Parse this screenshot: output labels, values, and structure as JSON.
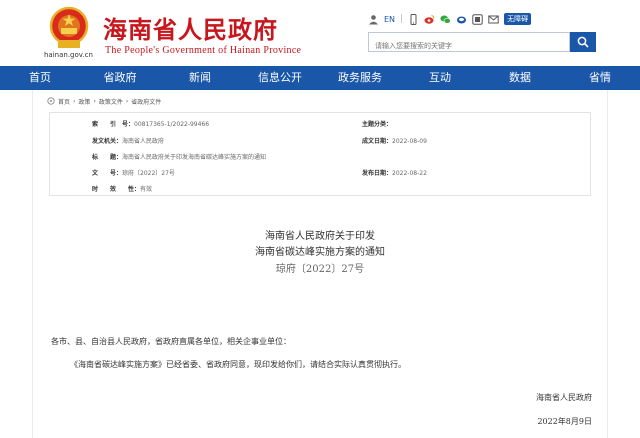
{
  "header": {
    "domain": "hainan.gov.cn",
    "title": "海南省人民政府",
    "subtitle": "The People's Government of Hainan Province",
    "tools": {
      "lang": "EN",
      "accessibility": "无障碍"
    },
    "search_placeholder": "请输入您要搜索的关键字"
  },
  "nav": [
    "首页",
    "省政府",
    "新闻",
    "信息公开",
    "政务服务",
    "互动",
    "数据",
    "省情"
  ],
  "breadcrumb": [
    "首页",
    "政策",
    "政策文件",
    "省政府文件"
  ],
  "meta": {
    "index_label": "索　　引　号：",
    "index_value": "00817365-1/2022-99466",
    "topic_label": "主题分类：",
    "topic_value": "",
    "issuer_label": "发文机关：",
    "issuer_value": "海南省人民政府",
    "created_label": "成文日期：",
    "created_value": "2022-08-09",
    "title_label": "标　　题：",
    "title_value": "海南省人民政府关于印发海南省碳达峰实施方案的通知",
    "docno_label": "文　　号：",
    "docno_value": "琼府〔2022〕27号",
    "published_label": "发布日期：",
    "published_value": "2022-08-22",
    "validity_label": "时　　效　　性：",
    "validity_value": "有效"
  },
  "document": {
    "title_line1": "海南省人民政府关于印发",
    "title_line2": "海南省碳达峰实施方案的通知",
    "doc_number": "琼府〔2022〕27号",
    "salutation": "各市、县、自治县人民政府，省政府直属各单位，相关企事业单位：",
    "body": "《海南省碳达峰实施方案》已经省委、省政府同意，现印发给你们，请结合实际认真贯彻执行。",
    "signature": "海南省人民政府",
    "date": "2022年8月9日"
  },
  "colors": {
    "brand_red": "#c8161d",
    "nav_blue": "#1a57a8"
  }
}
